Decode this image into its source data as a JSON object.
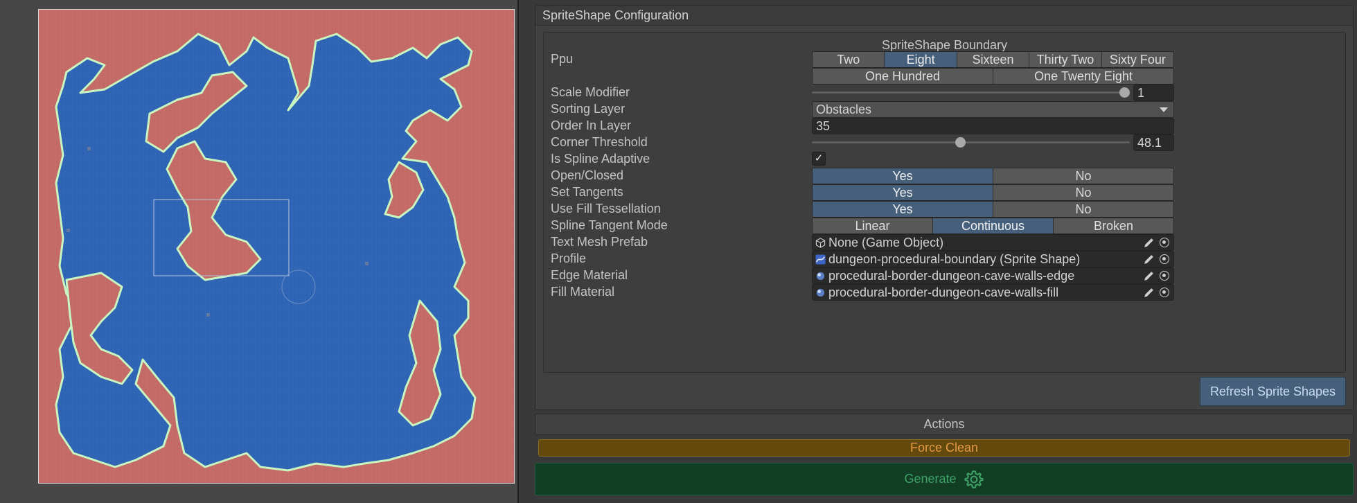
{
  "section": {
    "title": "SpriteShape Configuration",
    "boundary_title": "SpriteShape Boundary"
  },
  "ppu": {
    "label": "Ppu",
    "row1": [
      "Two",
      "Eight",
      "Sixteen",
      "Thirty Two",
      "Sixty Four"
    ],
    "row2": [
      "One Hundred",
      "One Twenty Eight"
    ],
    "selected": "Eight"
  },
  "scale_modifier": {
    "label": "Scale Modifier",
    "value": "1",
    "slider_fraction": 1.0
  },
  "sorting_layer": {
    "label": "Sorting Layer",
    "value": "Obstacles"
  },
  "order_in_layer": {
    "label": "Order In Layer",
    "value": "35"
  },
  "corner_threshold": {
    "label": "Corner Threshold",
    "value": "48.1",
    "slider_fraction": 0.5
  },
  "is_spline_adaptive": {
    "label": "Is Spline Adaptive",
    "checked": true,
    "check_glyph": "✓"
  },
  "open_closed": {
    "label": "Open/Closed",
    "options": [
      "Yes",
      "No"
    ],
    "selected": "Yes"
  },
  "set_tangents": {
    "label": "Set Tangents",
    "options": [
      "Yes",
      "No"
    ],
    "selected": "Yes"
  },
  "use_fill_tessellation": {
    "label": "Use Fill Tessellation",
    "options": [
      "Yes",
      "No"
    ],
    "selected": "Yes"
  },
  "spline_tangent_mode": {
    "label": "Spline Tangent Mode",
    "options": [
      "Linear",
      "Continuous",
      "Broken"
    ],
    "selected": "Continuous"
  },
  "text_mesh_prefab": {
    "label": "Text Mesh Prefab",
    "value": "None (Game Object)",
    "icon": "cube-icon"
  },
  "profile": {
    "label": "Profile",
    "value": "dungeon-procedural-boundary (Sprite Shape)",
    "icon": "sprite-shape-icon"
  },
  "edge_material": {
    "label": "Edge Material",
    "value": "procedural-border-dungeon-cave-walls-edge",
    "icon": "material-sphere-icon"
  },
  "fill_material": {
    "label": "Fill Material",
    "value": "procedural-border-dungeon-cave-walls-fill",
    "icon": "material-sphere-icon"
  },
  "refresh_label": "Refresh Sprite Shapes",
  "actions": {
    "title": "Actions",
    "force_clean_label": "Force Clean",
    "generate_label": "Generate"
  },
  "colors": {
    "accent_selected": "#46607c",
    "map_wall": "#c46a66",
    "map_floor": "#2f64b4",
    "map_border": "#c8f5c0",
    "force_clean_bg": "#634a0c",
    "generate_bg": "#123e26"
  }
}
